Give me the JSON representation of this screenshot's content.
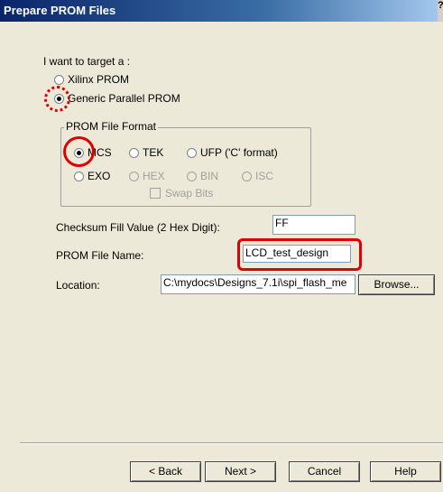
{
  "window": {
    "title": "Prepare PROM Files",
    "help_glyph": "?"
  },
  "target": {
    "prompt": "I want to target a :",
    "options": [
      {
        "label": "Xilinx PROM",
        "selected": false
      },
      {
        "label": "Generic Parallel PROM",
        "selected": true
      }
    ]
  },
  "prom_format": {
    "title": "PROM File Format",
    "options": [
      {
        "label": "MCS",
        "selected": true,
        "enabled": true
      },
      {
        "label": "TEK",
        "selected": false,
        "enabled": true
      },
      {
        "label": "UFP ('C' format)",
        "selected": false,
        "enabled": true
      },
      {
        "label": "EXO",
        "selected": false,
        "enabled": true
      },
      {
        "label": "HEX",
        "selected": false,
        "enabled": false
      },
      {
        "label": "BIN",
        "selected": false,
        "enabled": false
      },
      {
        "label": "ISC",
        "selected": false,
        "enabled": false
      }
    ],
    "swap_bits_label": "Swap Bits"
  },
  "fields": {
    "checksum_label": "Checksum Fill Value (2 Hex Digit):",
    "checksum_value": "FF",
    "filename_label": "PROM File Name:",
    "filename_value": "LCD_test_design",
    "location_label": "Location:",
    "location_value": "C:\\mydocs\\Designs_7.1i\\spi_flash_me",
    "browse_label": "Browse..."
  },
  "buttons": {
    "back": "< Back",
    "next": "Next >",
    "cancel": "Cancel",
    "help": "Help"
  },
  "colors": {
    "highlight": "#e00000",
    "titlebar": "#0a246a"
  }
}
